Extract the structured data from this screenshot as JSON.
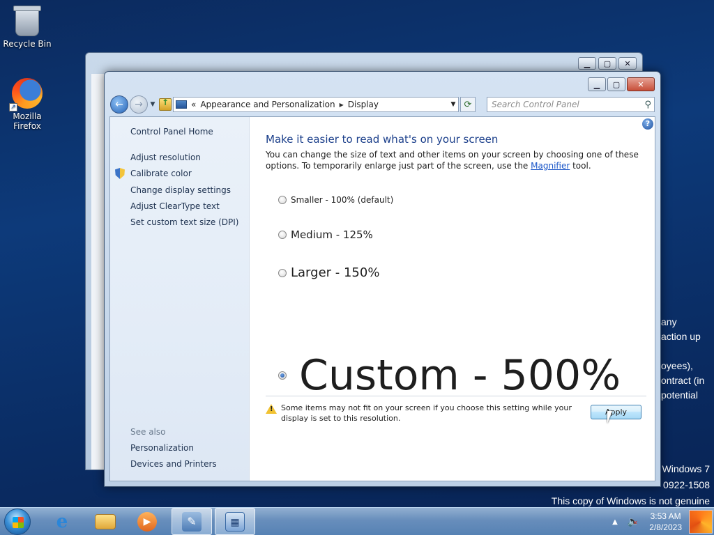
{
  "desktop": {
    "icons": [
      {
        "label": "Recycle Bin"
      },
      {
        "label": "Mozilla Firefox"
      }
    ],
    "background_lines": [
      "any",
      "action up",
      "",
      "oyees),",
      "ontract (in",
      "potential"
    ],
    "watermark": [
      "Windows 7",
      "0922-1508",
      "This copy of Windows is not genuine"
    ]
  },
  "window": {
    "breadcrumb": [
      "«",
      "Appearance and Personalization",
      "Display"
    ],
    "search_placeholder": "Search Control Panel",
    "left_pane": {
      "home": "Control Panel Home",
      "links": [
        "Adjust resolution",
        "Calibrate color",
        "Change display settings",
        "Adjust ClearType text",
        "Set custom text size (DPI)"
      ],
      "see_also_label": "See also",
      "see_also": [
        "Personalization",
        "Devices and Printers"
      ]
    },
    "main": {
      "help": "?",
      "heading": "Make it easier to read what's on your screen",
      "description_before": "You can change the size of text and other items on your screen by choosing one of these options. To temporarily enlarge just part of the screen, use the ",
      "description_link": "Magnifier",
      "description_after": " tool.",
      "options": [
        {
          "label": "Smaller - 100% (default)",
          "selected": false
        },
        {
          "label": "Medium - 125%",
          "selected": false
        },
        {
          "label": "Larger - 150%",
          "selected": false
        },
        {
          "label": "Custom - 500%",
          "selected": true
        }
      ],
      "warning": "Some items may not fit on your screen if you choose this setting while your display is set to this resolution.",
      "apply_label": "Apply"
    }
  },
  "taskbar": {
    "time": "3:53 AM",
    "date": "2/8/2023"
  }
}
